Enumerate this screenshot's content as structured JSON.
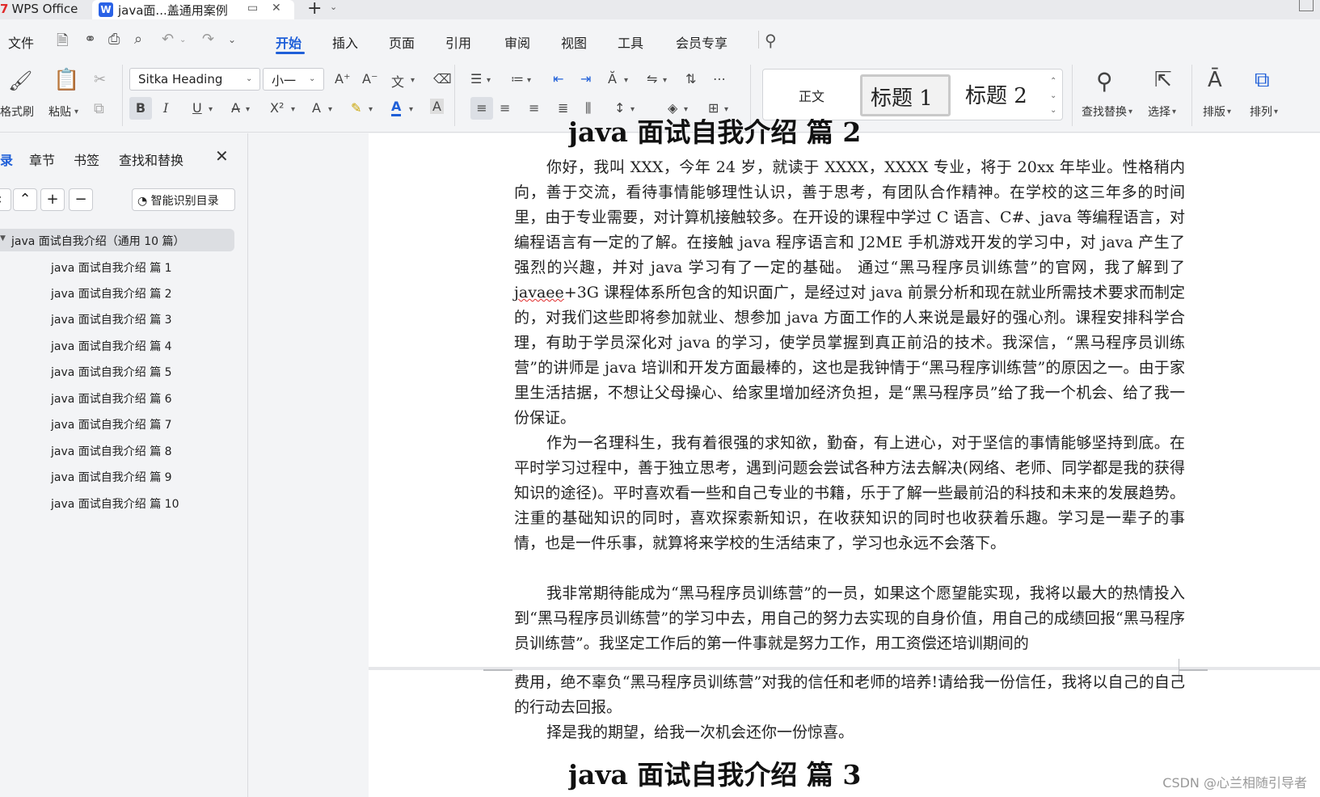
{
  "tabbar": {
    "home_tab": "WPS Office",
    "doc_tab": "java面...盖通用案例"
  },
  "menu": {
    "file": "文件",
    "tabs": [
      "开始",
      "插入",
      "页面",
      "引用",
      "审阅",
      "视图",
      "工具",
      "会员专享"
    ]
  },
  "ribbon": {
    "format_painter": "格式刷",
    "paste": "粘贴",
    "font_name": "Sitka Heading",
    "font_size": "小一",
    "style_normal": "正文",
    "style_h1": "标题 1",
    "style_h2": "标题 2",
    "find_replace": "查找替换",
    "select": "选择",
    "layout": "排版",
    "arrange": "排列"
  },
  "nav": {
    "tabs": [
      "录",
      "章节",
      "书签",
      "查找和替换"
    ],
    "smart_toc": "智能识别目录",
    "root": "java 面试自我介绍（通用 10 篇）",
    "items": [
      "java 面试自我介绍 篇 1",
      "java 面试自我介绍 篇 2",
      "java 面试自我介绍 篇 3",
      "java 面试自我介绍 篇 4",
      "java 面试自我介绍 篇 5",
      "java 面试自我介绍 篇 6",
      "java 面试自我介绍 篇 7",
      "java 面试自我介绍 篇 8",
      "java 面试自我介绍 篇 9",
      "java 面试自我介绍 篇 10"
    ]
  },
  "doc": {
    "top_heading": "java 面试自我介绍 篇 2",
    "p1_a": "你好，我叫 XXX，今年 24 岁，就读于 XXXX，XXXX 专业，将于 20xx 年毕业。性格稍内向，善于交流，看待事情能够理性认识，善于思考，有团队合作精神。在学校的这三年多的时间里，由于专业需要，对计算机接触较多。在开设的课程中学过 C 语言、C#、java 等编程语言，对编程语言有一定的了解。在接触 java 程序语言和 J2ME 手机游戏开发的学习中，对 java 产生了强烈的兴趣，并对 java 学习有了一定的基础。 通过“黑马程序员训练营”的官网，我了解到了 ",
    "p1_sq": "javaee",
    "p1_b": "+3G 课程体系所包含的知识面广，是经过对 java 前景分析和现在就业所需技术要求而制定的，对我们这些即将参加就业、想参加 java 方面工作的人来说是最好的强心剂。课程安排科学合理，有助于学员深化对 java 的学习，使学员掌握到真正前沿的技术。我深信，“黑马程序员训练营”的讲师是 java 培训和开发方面最棒的，这也是我钟情于“黑马程序训练营”的原因之一。由于家里生活拮据，不想让父母操心、给家里增加经济负担，是“黑马程序员”给了我一个机会、给了我一份保证。",
    "p2": "作为一名理科生，我有着很强的求知欲，勤奋，有上进心，对于坚信的事情能够坚持到底。在平时学习过程中，善于独立思考，遇到问题会尝试各种方法去解决(网络、老师、同学都是我的获得知识的途径)。平时喜欢看一些和自己专业的书籍，乐于了解一些最前沿的科技和未来的发展趋势。注重的基础知识的同时，喜欢探索新知识，在收获知识的同时也收获着乐趣。学习是一辈子的事情，也是一件乐事，就算将来学校的生活结束了，学习也永远不会落下。",
    "p3_page1": "我非常期待能成为“黑马程序员训练营”的一员，如果这个愿望能实现，我将以最大的热情投入到“黑马程序员训练营”的学习中去，用自己的努力去实现的自身价值，用自己的成绩回报“黑马程序员训练营”。我坚定工作后的第一件事就是努力工作，用工资偿还培训期间的",
    "p3_page2": "费用，绝不辜负“黑马程序员训练营”对我的信任和老师的培养!请给我一份信任，我将以自己的自己的行动去回报。",
    "p4": "择是我的期望，给我一次机会还你一份惊喜。",
    "bottom_heading": "java 面试自我介绍 篇 3"
  },
  "watermark": "CSDN @心兰相随引导者",
  "colors": {
    "accent": "#1f5fd8",
    "wps_red": "#e02a2a"
  }
}
